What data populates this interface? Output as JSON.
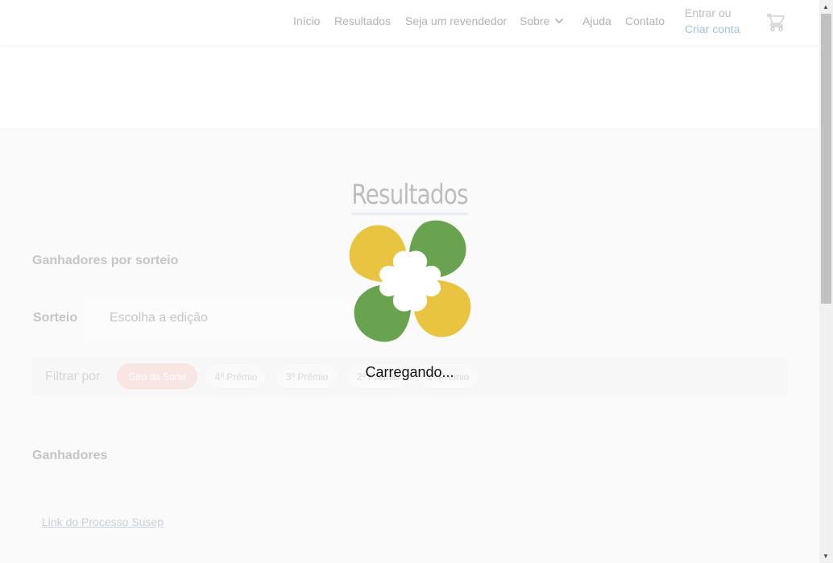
{
  "nav": {
    "inicio": "Início",
    "resultados": "Resultados",
    "revendedor": "Seja um revendedor",
    "sobre": "Sobre",
    "ajuda": "Ajuda",
    "contato": "Contato"
  },
  "account": {
    "entrar": "Entrar ou",
    "criar": "Criar conta"
  },
  "page": {
    "title": "Resultados",
    "ganhadores_por_sorteio": "Ganhadores por sorteio",
    "sorteio_label": "Sorteio",
    "edicao_placeholder": "Escolha a edição",
    "filtrar_label": "Filtrar por",
    "chips": [
      "Giro da Sorte",
      "4º Prêmio",
      "3º Prêmio",
      "2º Prêmio",
      "1º Prêmio"
    ],
    "ganhadores": "Ganhadores",
    "susep_link": "Link do Processo Susep"
  },
  "loader": {
    "text": "Carregando..."
  },
  "icons": {
    "cart": "cart-icon",
    "chevron": "chevron-down-icon",
    "logo": "clover-logo"
  },
  "colors": {
    "logo_yellow": "#e9c440",
    "logo_green": "#6aa34f",
    "chip_active": "#f6d9d4"
  }
}
